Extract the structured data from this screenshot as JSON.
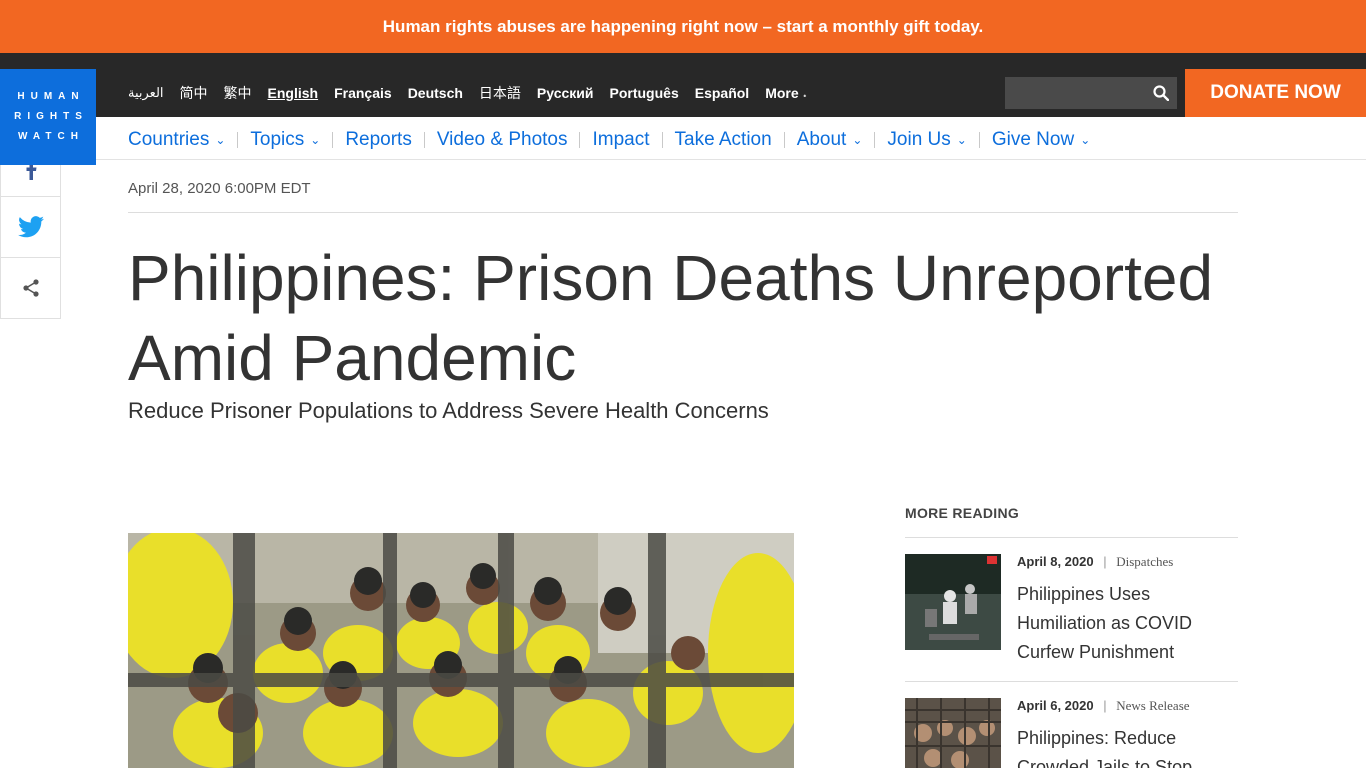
{
  "promo_banner": {
    "text": "Human rights abuses are happening right now – start a monthly gift today."
  },
  "logo": {
    "lines": [
      "HUMAN",
      "RIGHTS",
      "WATCH"
    ]
  },
  "languages": {
    "items": [
      "العربية",
      "简中",
      "繁中",
      "English",
      "Français",
      "Deutsch",
      "日本語",
      "Русский",
      "Português",
      "Español",
      "More"
    ],
    "active": "English"
  },
  "search": {
    "placeholder": ""
  },
  "donate_label": "DONATE NOW",
  "nav": {
    "items": [
      {
        "label": "Countries",
        "dropdown": true
      },
      {
        "label": "Topics",
        "dropdown": true
      },
      {
        "label": "Reports",
        "dropdown": false
      },
      {
        "label": "Video & Photos",
        "dropdown": false
      },
      {
        "label": "Impact",
        "dropdown": false
      },
      {
        "label": "Take Action",
        "dropdown": false
      },
      {
        "label": "About",
        "dropdown": true
      },
      {
        "label": "Join Us",
        "dropdown": true
      },
      {
        "label": "Give Now",
        "dropdown": true
      }
    ]
  },
  "social": {
    "icons": [
      "facebook-icon",
      "twitter-icon",
      "share-icon"
    ]
  },
  "article": {
    "date": "April 28, 2020 6:00PM EDT",
    "title": "Philippines: Prison Deaths Unreported Amid Pandemic",
    "subtitle": "Reduce Prisoner Populations to Address Severe Health Concerns"
  },
  "more_reading": {
    "label": "MORE READING",
    "items": [
      {
        "date": "April 8, 2020",
        "type": "Dispatches",
        "title": "Philippines Uses Humiliation as COVID Curfew Punishment"
      },
      {
        "date": "April 6, 2020",
        "type": "News Release",
        "title": "Philippines: Reduce Crowded Jails to Stop"
      }
    ]
  },
  "colors": {
    "accent_orange": "#f26722",
    "brand_blue": "#0d6edc",
    "dark_bar": "#282828"
  }
}
